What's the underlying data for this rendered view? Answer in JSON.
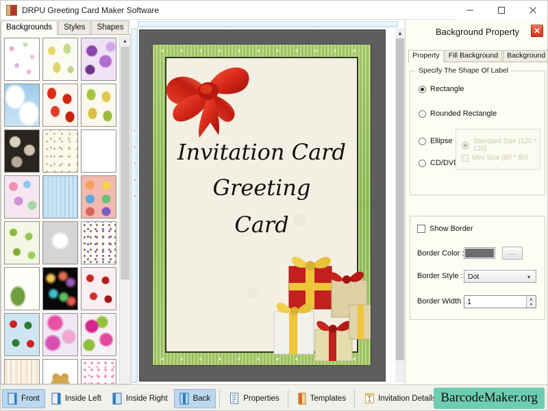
{
  "window": {
    "title": "DRPU Greeting Card Maker Software",
    "app_icon": "app-icon",
    "minimize": "─",
    "maximize": "□",
    "close": "✕"
  },
  "left_panel": {
    "tabs": [
      {
        "label": "Backgrounds",
        "active": true
      },
      {
        "label": "Styles",
        "active": false
      },
      {
        "label": "Shapes",
        "active": false
      }
    ],
    "scrollbar": {
      "up": "▲",
      "down": "▼"
    },
    "thumbnails": [
      {
        "name": "pastel-scribble-pattern"
      },
      {
        "name": "pears-and-leaves-pattern"
      },
      {
        "name": "purple-floral-splash-pattern"
      },
      {
        "name": "blue-sky-clouds-pattern"
      },
      {
        "name": "red-strawberry-pattern"
      },
      {
        "name": "green-yellow-leaf-pattern"
      },
      {
        "name": "dark-roses-pattern"
      },
      {
        "name": "confetti-sprinkle-pattern"
      },
      {
        "name": "colorful-gift-boxes-pattern"
      },
      {
        "name": "bright-floral-pattern"
      },
      {
        "name": "blue-wood-dandelion-pattern"
      },
      {
        "name": "circles-flowers-grid-pattern"
      },
      {
        "name": "green-pine-trees-pattern"
      },
      {
        "name": "white-dandelion-pattern"
      },
      {
        "name": "party-doodles-pattern"
      },
      {
        "name": "white-green-leaf-pattern"
      },
      {
        "name": "black-fireworks-pattern"
      },
      {
        "name": "red-hearts-pattern"
      },
      {
        "name": "santa-christmas-pattern"
      },
      {
        "name": "pink-floral-blur-pattern"
      },
      {
        "name": "magenta-green-flowers-pattern"
      },
      {
        "name": "pastel-stripes-pattern"
      },
      {
        "name": "teddy-bear-pattern"
      },
      {
        "name": "pink-baby-doodles-pattern"
      }
    ]
  },
  "canvas": {
    "ruler_ticks": [
      "1",
      "2",
      "3",
      "4",
      "5"
    ],
    "scrollbar": {
      "up": "▲",
      "down": "▼"
    },
    "card": {
      "lines": [
        "Invitation Card",
        "Greeting",
        "Card"
      ],
      "bow_icon": "red-ribbon-bow-graphic",
      "gifts_icon": "gift-boxes-graphic"
    }
  },
  "right_panel": {
    "title": "Background Property",
    "close_label": "✕",
    "tabs": [
      {
        "label": "Property",
        "active": true
      },
      {
        "label": "Fill Background",
        "active": false
      },
      {
        "label": "Background Effects",
        "active": false
      }
    ],
    "shape_group": {
      "legend": "Specify The Shape Of Label",
      "options": [
        {
          "label": "Rectangle",
          "selected": true,
          "disabled": false
        },
        {
          "label": "Rounded Rectangle",
          "selected": false,
          "disabled": false
        },
        {
          "label": "Ellipse",
          "selected": false,
          "disabled": false
        },
        {
          "label": "CD/DVD",
          "selected": false,
          "disabled": false
        }
      ],
      "sizes": [
        {
          "label": "Standard Size (120 * 120)",
          "selected": true,
          "disabled": true
        },
        {
          "label": "Mini Size (80 * 80)",
          "selected": false,
          "disabled": true
        }
      ]
    },
    "border_group": {
      "show_border_label": "Show Border",
      "show_border_checked": false,
      "color_label": "Border Color :",
      "color_value": "#6e6e6e",
      "color_picker_label": "...",
      "style_label": "Border Style :",
      "style_value": "Dot",
      "style_caret": "▾",
      "width_label": "Border Width :",
      "width_value": "1",
      "spin_up": "▴",
      "spin_down": "▾"
    }
  },
  "bottom_bar": {
    "buttons": [
      {
        "label": "Front",
        "icon": "card-front-icon",
        "selected": true
      },
      {
        "label": "Inside Left",
        "icon": "card-inside-left-icon",
        "selected": false
      },
      {
        "label": "Inside Right",
        "icon": "card-inside-right-icon",
        "selected": false
      },
      {
        "label": "Back",
        "icon": "card-back-icon",
        "selected": true
      },
      {
        "label": "Properties",
        "icon": "properties-icon",
        "selected": false
      },
      {
        "label": "Templates",
        "icon": "templates-icon",
        "selected": false
      },
      {
        "label": "Invitation Details",
        "icon": "invitation-details-icon",
        "selected": false
      }
    ],
    "watermark": "BarcodeMaker.org",
    "watermark_color": "#6ecdb0"
  }
}
